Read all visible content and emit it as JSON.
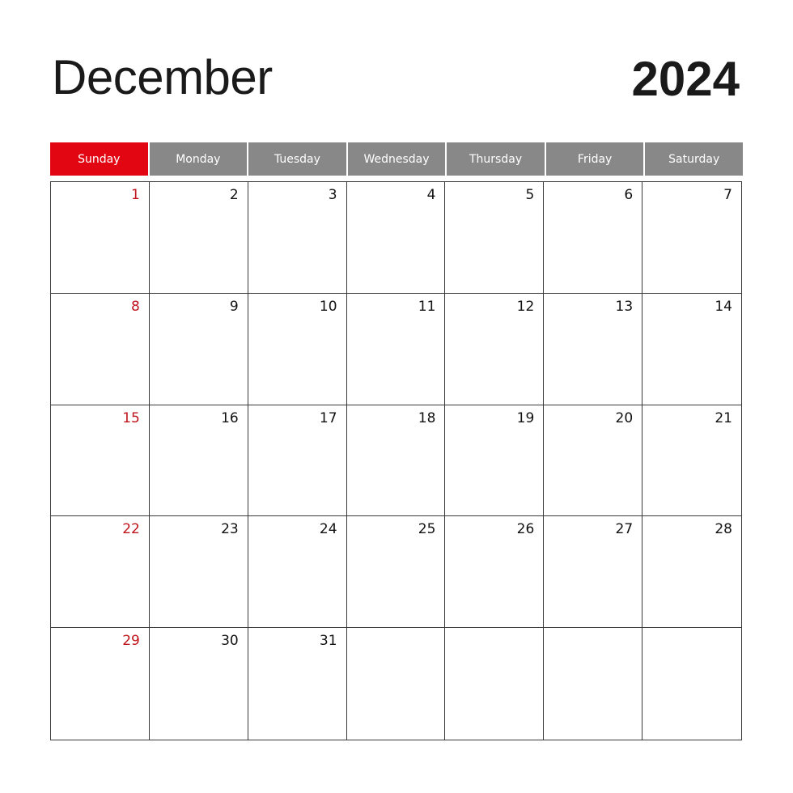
{
  "title": {
    "month": "December",
    "year": "2024"
  },
  "colors": {
    "sunday_header": "#e20613",
    "weekday_header": "#888888",
    "sunday_number": "#c0141c",
    "grid_line": "#3a3a3a"
  },
  "weekdays": [
    "Sunday",
    "Monday",
    "Tuesday",
    "Wednesday",
    "Thursday",
    "Friday",
    "Saturday"
  ],
  "weeks": [
    [
      "1",
      "2",
      "3",
      "4",
      "5",
      "6",
      "7"
    ],
    [
      "8",
      "9",
      "10",
      "11",
      "12",
      "13",
      "14"
    ],
    [
      "15",
      "16",
      "17",
      "18",
      "19",
      "20",
      "21"
    ],
    [
      "22",
      "23",
      "24",
      "25",
      "26",
      "27",
      "28"
    ],
    [
      "29",
      "30",
      "31",
      "",
      "",
      "",
      ""
    ]
  ]
}
